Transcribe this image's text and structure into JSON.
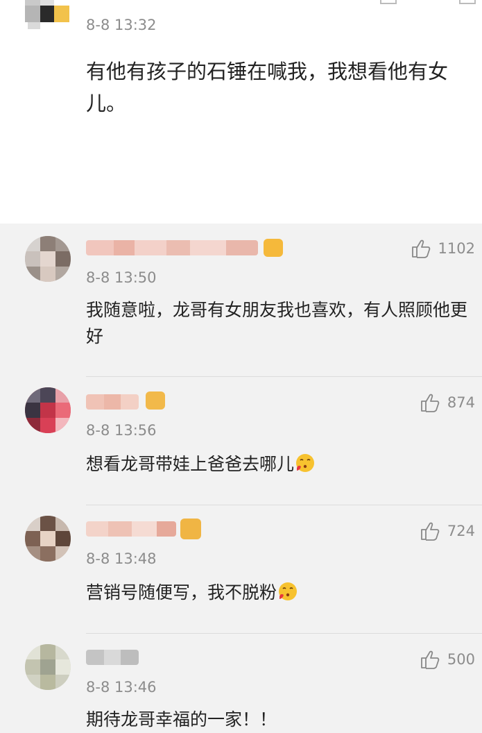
{
  "top_comment": {
    "timestamp": "8-8 13:32",
    "text": "有他有孩子的石锤在喊我，我想看他有女儿。"
  },
  "comments": [
    {
      "timestamp": "8-8 13:50",
      "text": "我随意啦，龙哥有女朋友我也喜欢，有人照顾他更好",
      "likes": "1102",
      "emoji": false
    },
    {
      "timestamp": "8-8 13:56",
      "text": "想看龙哥带娃上爸爸去哪儿",
      "likes": "874",
      "emoji": true
    },
    {
      "timestamp": "8-8 13:48",
      "text": "营销号随便写，我不脱粉",
      "likes": "724",
      "emoji": true
    },
    {
      "timestamp": "8-8 13:46",
      "text": "期待龙哥幸福的一家！！",
      "likes": "500",
      "emoji": false
    }
  ],
  "icons": {
    "like": "thumbs-up-icon",
    "emoji": "kiss-face-emoji-icon"
  },
  "colors": {
    "background": "#f2f2f2",
    "top_background": "#ffffff",
    "meta_text": "#8c8c8c",
    "badge": "#f5b93b"
  }
}
